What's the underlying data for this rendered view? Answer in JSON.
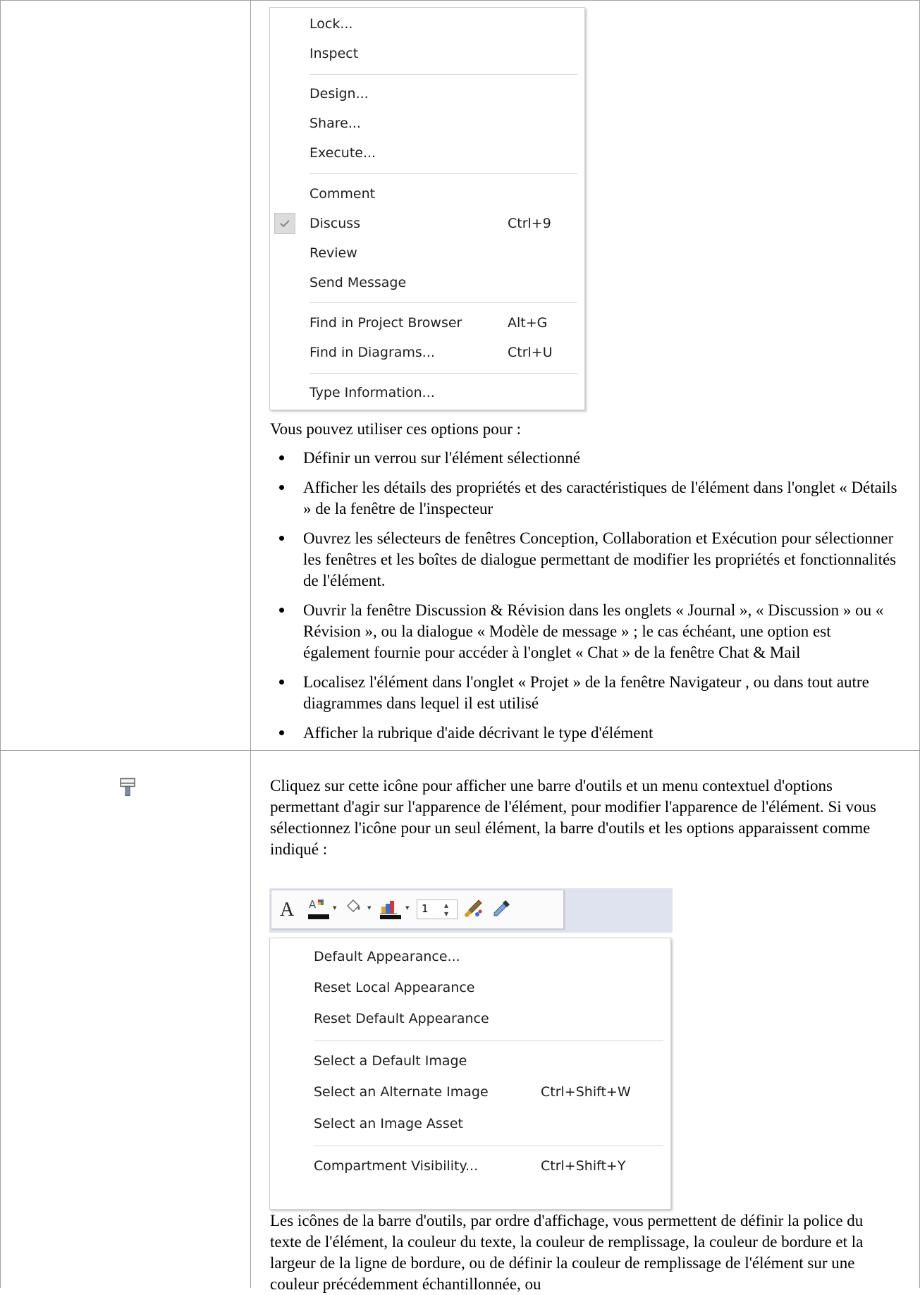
{
  "menu1": {
    "items": [
      {
        "label": "Lock...",
        "shortcut": ""
      },
      {
        "label": "Inspect",
        "shortcut": ""
      },
      {
        "label": "Design...",
        "shortcut": ""
      },
      {
        "label": "Share...",
        "shortcut": ""
      },
      {
        "label": "Execute...",
        "shortcut": ""
      },
      {
        "label": "Comment",
        "shortcut": ""
      },
      {
        "label": "Discuss",
        "shortcut": "Ctrl+9",
        "checked": true
      },
      {
        "label": "Review",
        "shortcut": ""
      },
      {
        "label": "Send Message",
        "shortcut": ""
      },
      {
        "label": "Find in Project Browser",
        "shortcut": "Alt+G"
      },
      {
        "label": "Find in Diagrams...",
        "shortcut": "Ctrl+U"
      },
      {
        "label": "Type Information...",
        "shortcut": ""
      }
    ]
  },
  "section1": {
    "intro": "Vous pouvez utiliser ces options pour :",
    "bullets": [
      "Définir un verrou sur l'élément sélectionné",
      "Afficher les détails des propriétés et des caractéristiques de l'élément dans l'onglet « Détails » de la fenêtre de l'inspecteur",
      "Ouvrez les sélecteurs de fenêtres Conception, Collaboration et Exécution pour sélectionner les fenêtres et les boîtes de dialogue permettant de modifier les propriétés et fonctionnalités de l'élément.",
      "Ouvrir la fenêtre Discussion & Révision dans les onglets « Journal », « Discussion » ou « Révision », ou la dialogue « Modèle de message » ; le cas échéant, une option est également fournie pour accéder à l'onglet « Chat » de la fenêtre Chat & Mail",
      "Localisez l'élément dans l'onglet « Projet » de la fenêtre Navigateur , ou dans tout autre diagrammes dans lequel il est utilisé",
      "Afficher la rubrique d'aide décrivant le type d'élément"
    ]
  },
  "section2": {
    "icon": "paint-roller-icon",
    "description": "Cliquez sur cette icône pour afficher une barre d'outils et un menu contextuel d'options permettant d'agir sur l'apparence de l'élément, pour modifier l'apparence de l'élément. Si vous sélectionnez l'icône pour un seul élément, la barre d'outils et les options apparaissent comme indiqué :",
    "toolbar": {
      "font_glyph": "A",
      "line_width": "1",
      "icons": [
        "font-icon",
        "text-color-icon",
        "fill-color-icon",
        "border-color-icon",
        "line-width-spinner",
        "paint-brush-icon",
        "eyedropper-icon"
      ]
    },
    "menu2": {
      "items": [
        {
          "label": "Default Appearance...",
          "shortcut": ""
        },
        {
          "label": "Reset Local Appearance",
          "shortcut": ""
        },
        {
          "label": "Reset Default Appearance",
          "shortcut": ""
        },
        {
          "label": "Select a Default Image",
          "shortcut": ""
        },
        {
          "label": "Select an Alternate Image",
          "shortcut": "Ctrl+Shift+W"
        },
        {
          "label": "Select an Image Asset",
          "shortcut": ""
        },
        {
          "label": "Compartment Visibility...",
          "shortcut": "Ctrl+Shift+Y"
        }
      ]
    },
    "footer_text": "Les icônes de la barre d'outils, par ordre d'affichage, vous permettent de définir la police du texte de l'élément, la couleur du texte, la couleur de remplissage, la couleur de bordure et la largeur de la ligne de bordure, ou de définir la couleur de remplissage de l'élément sur une couleur précédemment échantillonnée, ou"
  }
}
